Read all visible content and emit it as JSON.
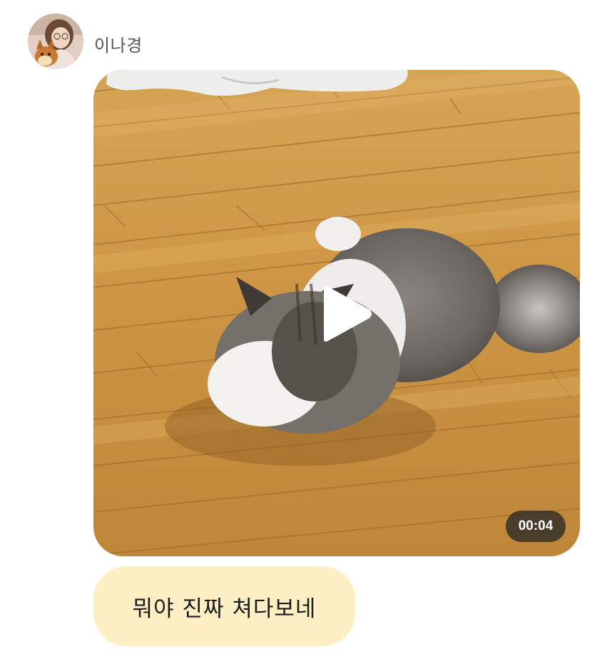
{
  "sender": {
    "name": "이나경",
    "avatar_icon": "profile-photo-avatar"
  },
  "video_message": {
    "thumbnail": "video-thumbnail",
    "play_icon": "play-icon",
    "duration": "00:04",
    "badge_color": "#2b2b2b"
  },
  "text_message": {
    "text": "뭐야 진짜 쳐다보네",
    "bubble_color": "#fdefc3"
  }
}
